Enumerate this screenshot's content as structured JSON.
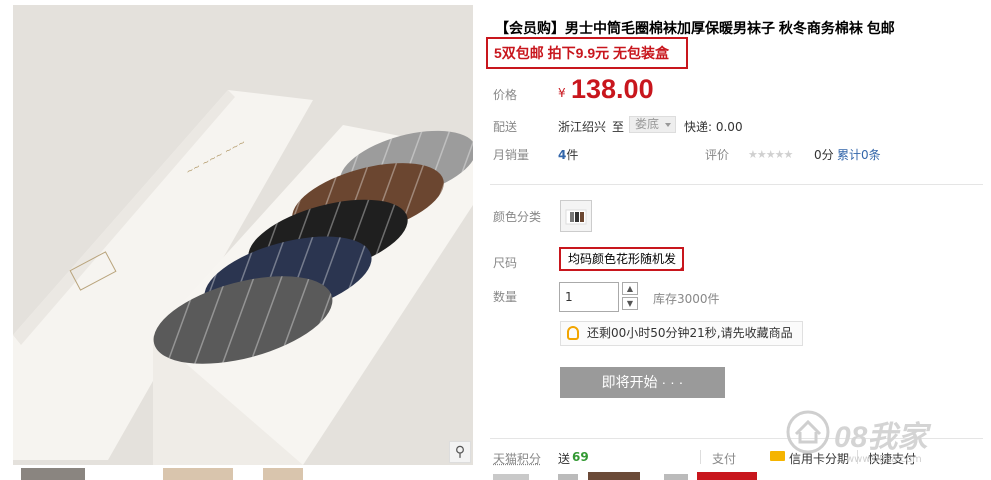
{
  "product": {
    "title": "【会员购】男士中筒毛圈棉袜加厚保暖男袜子 秋冬商务棉袜 包邮",
    "promo": "5双包邮 拍下9.9元 无包装盒"
  },
  "price": {
    "label": "价格",
    "currency": "¥",
    "value": "138.00"
  },
  "shipping": {
    "label": "配送",
    "from": "浙江绍兴",
    "to_word": "至",
    "destination": "娄底",
    "express": "快递: 0.00"
  },
  "sales": {
    "label": "月销量",
    "count": "4",
    "unit": "件",
    "rating_label": "评价",
    "score": "0分",
    "reviews": "累计0条"
  },
  "options": {
    "color_label": "颜色分类",
    "size_label": "尺码",
    "size_value": "均码颜色花形随机发",
    "qty_label": "数量",
    "qty_value": "1",
    "stock": "库存3000件"
  },
  "notice": {
    "text": "还剩00小时50分钟21秒,请先收藏商品"
  },
  "buy": {
    "label": "即将开始 · · ·"
  },
  "footer": {
    "points_label": "天猫积分",
    "points_send": "送",
    "points_value": "69",
    "pay_label": "支付",
    "card_pay": "信用卡分期",
    "quick_pay": "快捷支付"
  },
  "watermark": {
    "text": "08我家",
    "url": "www.08jia.com"
  },
  "colors": {
    "accent": "#c8161d",
    "link": "#3366aa",
    "button": "#9a9a9a"
  }
}
